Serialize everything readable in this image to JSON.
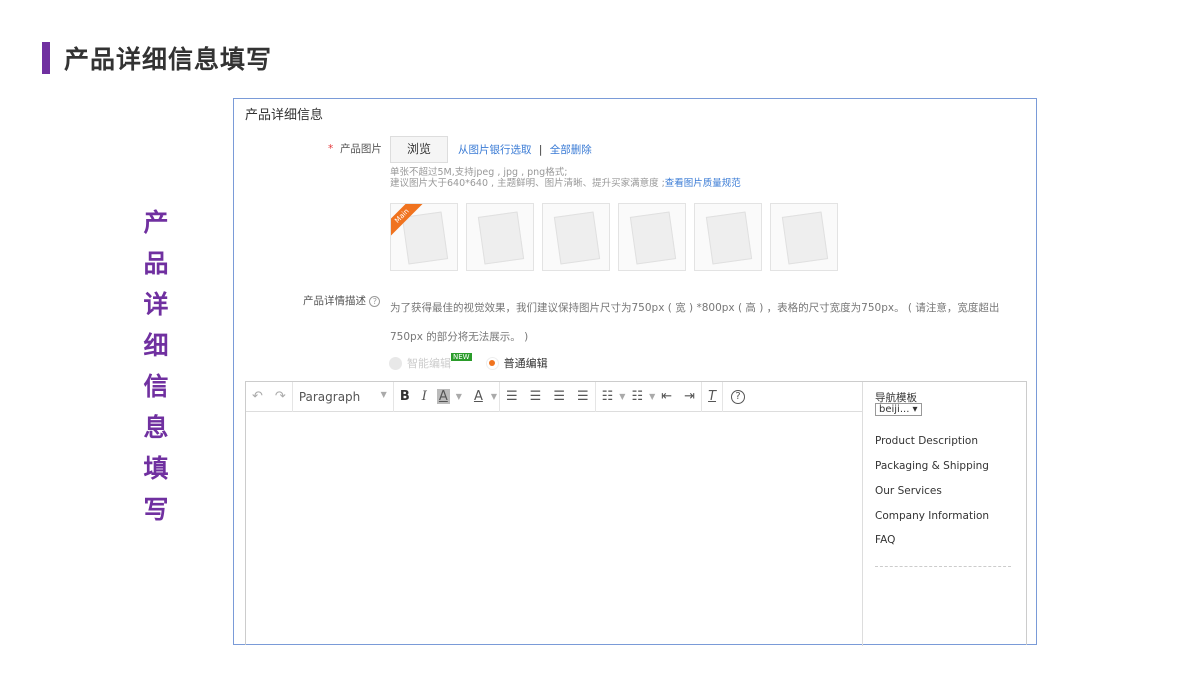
{
  "page_title": "产品详细信息填写",
  "vertical_title": "产品详细信息填写",
  "accent": "#7030a0",
  "panel": {
    "title": "产品详细信息",
    "image_label": "产品图片",
    "required_mark": "*",
    "browse_button": "浏览",
    "from_bank_link": "从图片银行选取",
    "link_separator": "|",
    "delete_all_link": "全部删除",
    "hint_line1": "单张不超过5M,支持jpeg , jpg , png格式;",
    "hint_line2": "建议图片大于640*640 , 主题鲜明、图片清晰、提升买家满意度 ;",
    "quality_link": "查看图片质量规范",
    "main_badge": "Main",
    "desc_label": "产品详情描述",
    "desc_text": "为了获得最佳的视觉效果，我们建议保持图片尺寸为750px ( 宽 ) *800px ( 高 ) ，表格的尺寸宽度为750px。 ( 请注意，宽度超出750px 的部分将无法展示。 )",
    "smart_edit": "智能编辑",
    "new_badge": "NEW",
    "normal_edit": "普通编辑"
  },
  "editor": {
    "format_select": "Paragraph",
    "nav_template_label": "导航模板",
    "nav_template_value": "beiji...",
    "nav_items": [
      "Product Description",
      "Packaging & Shipping",
      "Our Services",
      "Company Information",
      "FAQ"
    ]
  }
}
